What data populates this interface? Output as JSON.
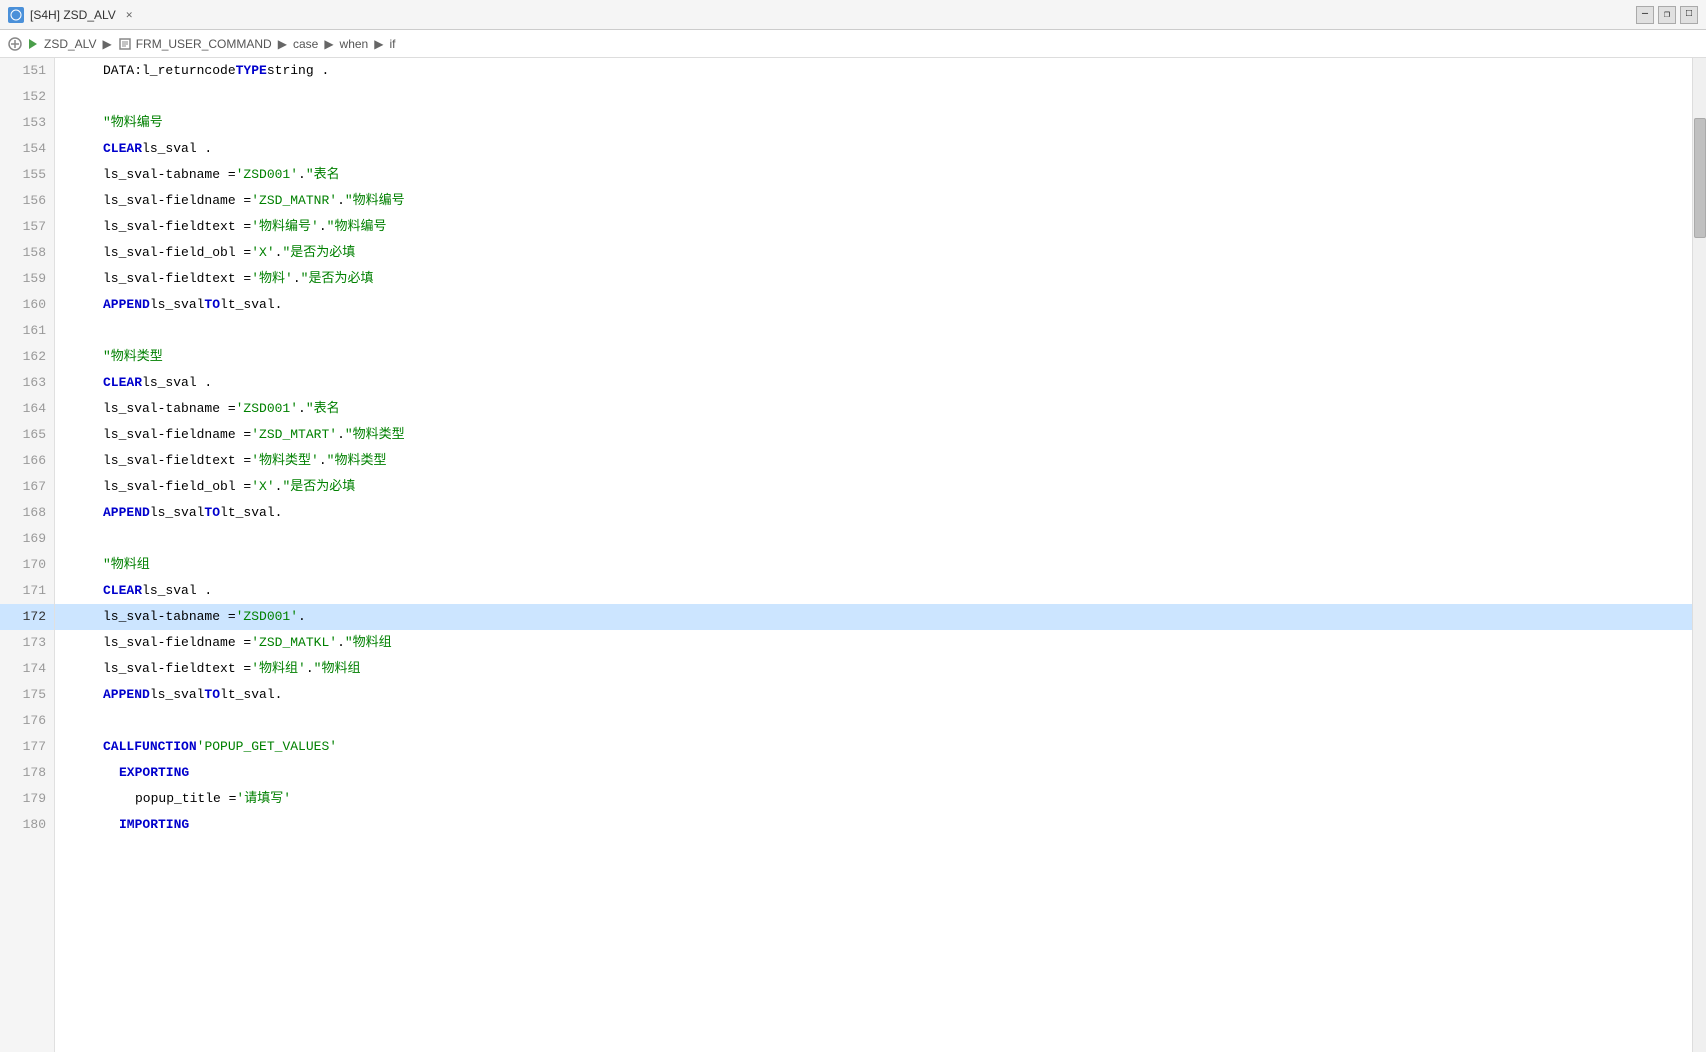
{
  "window": {
    "title": "[S4H] ZSD_ALV",
    "close_label": "✕"
  },
  "breadcrumb": {
    "items": [
      "ZSD_ALV",
      "FRM_USER_COMMAND",
      "case",
      "when",
      "if"
    ]
  },
  "window_controls": {
    "minimize": "—",
    "maximize": "□",
    "restore": "❐"
  },
  "lines": [
    {
      "num": "151",
      "active": false,
      "tokens": [
        {
          "type": "indent",
          "w": 32
        },
        {
          "type": "plain",
          "text": "DATA:l_returncode "
        },
        {
          "type": "kw",
          "text": "TYPE"
        },
        {
          "type": "plain",
          "text": " string ."
        }
      ]
    },
    {
      "num": "152",
      "active": false,
      "tokens": []
    },
    {
      "num": "153",
      "active": false,
      "tokens": [
        {
          "type": "indent",
          "w": 32
        },
        {
          "type": "comment",
          "text": "\"物料编号"
        }
      ]
    },
    {
      "num": "154",
      "active": false,
      "tokens": [
        {
          "type": "indent",
          "w": 32
        },
        {
          "type": "kw",
          "text": "CLEAR"
        },
        {
          "type": "plain",
          "text": " ls_sval ."
        }
      ]
    },
    {
      "num": "155",
      "active": false,
      "tokens": [
        {
          "type": "indent",
          "w": 32
        },
        {
          "type": "plain",
          "text": "ls_sval-tabname = "
        },
        {
          "type": "str",
          "text": "'ZSD001'"
        },
        {
          "type": "plain",
          "text": " .   "
        },
        {
          "type": "comment",
          "text": "\"表名"
        }
      ]
    },
    {
      "num": "156",
      "active": false,
      "tokens": [
        {
          "type": "indent",
          "w": 32
        },
        {
          "type": "plain",
          "text": "ls_sval-fieldname = "
        },
        {
          "type": "str",
          "text": "'ZSD_MATNR'"
        },
        {
          "type": "plain",
          "text": " . "
        },
        {
          "type": "comment",
          "text": "\"物料编号"
        }
      ]
    },
    {
      "num": "157",
      "active": false,
      "tokens": [
        {
          "type": "indent",
          "w": 32
        },
        {
          "type": "plain",
          "text": "ls_sval-fieldtext = "
        },
        {
          "type": "str",
          "text": "'物料编号'"
        },
        {
          "type": "plain",
          "text": " . "
        },
        {
          "type": "comment",
          "text": "\"物料编号"
        }
      ]
    },
    {
      "num": "158",
      "active": false,
      "tokens": [
        {
          "type": "indent",
          "w": 32
        },
        {
          "type": "plain",
          "text": "ls_sval-field_obl = "
        },
        {
          "type": "str",
          "text": "'X'"
        },
        {
          "type": "plain",
          "text": " .              "
        },
        {
          "type": "comment",
          "text": "\"是否为必填"
        }
      ]
    },
    {
      "num": "159",
      "active": false,
      "tokens": [
        {
          "type": "indent",
          "w": 32
        },
        {
          "type": "plain",
          "text": "ls_sval-fieldtext = "
        },
        {
          "type": "str",
          "text": "'物料'"
        },
        {
          "type": "plain",
          "text": " .              "
        },
        {
          "type": "comment",
          "text": "\"是否为必填"
        }
      ]
    },
    {
      "num": "160",
      "active": false,
      "tokens": [
        {
          "type": "indent",
          "w": 32
        },
        {
          "type": "kw",
          "text": "APPEND"
        },
        {
          "type": "plain",
          "text": " ls_sval "
        },
        {
          "type": "kw",
          "text": "TO"
        },
        {
          "type": "plain",
          "text": " lt_sval."
        }
      ]
    },
    {
      "num": "161",
      "active": false,
      "tokens": []
    },
    {
      "num": "162",
      "active": false,
      "tokens": [
        {
          "type": "indent",
          "w": 32
        },
        {
          "type": "comment",
          "text": "\"物料类型"
        }
      ]
    },
    {
      "num": "163",
      "active": false,
      "tokens": [
        {
          "type": "indent",
          "w": 32
        },
        {
          "type": "kw",
          "text": "CLEAR"
        },
        {
          "type": "plain",
          "text": " ls_sval ."
        }
      ]
    },
    {
      "num": "164",
      "active": false,
      "tokens": [
        {
          "type": "indent",
          "w": 32
        },
        {
          "type": "plain",
          "text": "ls_sval-tabname = "
        },
        {
          "type": "str",
          "text": "'ZSD001'"
        },
        {
          "type": "plain",
          "text": " .   "
        },
        {
          "type": "comment",
          "text": "\"表名"
        }
      ]
    },
    {
      "num": "165",
      "active": false,
      "tokens": [
        {
          "type": "indent",
          "w": 32
        },
        {
          "type": "plain",
          "text": "ls_sval-fieldname = "
        },
        {
          "type": "str",
          "text": "'ZSD_MTART'"
        },
        {
          "type": "plain",
          "text": " . "
        },
        {
          "type": "comment",
          "text": "\"物料类型"
        }
      ]
    },
    {
      "num": "166",
      "active": false,
      "tokens": [
        {
          "type": "indent",
          "w": 32
        },
        {
          "type": "plain",
          "text": "ls_sval-fieldtext = "
        },
        {
          "type": "str",
          "text": "'物料类型'"
        },
        {
          "type": "plain",
          "text": " . "
        },
        {
          "type": "comment",
          "text": "\"物料类型"
        }
      ]
    },
    {
      "num": "167",
      "active": false,
      "tokens": [
        {
          "type": "indent",
          "w": 32
        },
        {
          "type": "plain",
          "text": "ls_sval-field_obl = "
        },
        {
          "type": "str",
          "text": "'X'"
        },
        {
          "type": "plain",
          "text": " .              "
        },
        {
          "type": "comment",
          "text": "\"是否为必填"
        }
      ]
    },
    {
      "num": "168",
      "active": false,
      "tokens": [
        {
          "type": "indent",
          "w": 32
        },
        {
          "type": "kw",
          "text": "APPEND"
        },
        {
          "type": "plain",
          "text": " ls_sval "
        },
        {
          "type": "kw",
          "text": "TO"
        },
        {
          "type": "plain",
          "text": " lt_sval."
        }
      ]
    },
    {
      "num": "169",
      "active": false,
      "tokens": []
    },
    {
      "num": "170",
      "active": false,
      "tokens": [
        {
          "type": "indent",
          "w": 32
        },
        {
          "type": "comment",
          "text": "\"物料组"
        }
      ]
    },
    {
      "num": "171",
      "active": false,
      "tokens": [
        {
          "type": "indent",
          "w": 32
        },
        {
          "type": "kw",
          "text": "CLEAR"
        },
        {
          "type": "plain",
          "text": " ls_sval ."
        }
      ]
    },
    {
      "num": "172",
      "active": true,
      "tokens": [
        {
          "type": "indent",
          "w": 32
        },
        {
          "type": "plain",
          "text": "ls_sval-tabname = "
        },
        {
          "type": "str",
          "text": "'ZSD001'"
        },
        {
          "type": "plain",
          "text": "."
        }
      ]
    },
    {
      "num": "173",
      "active": false,
      "tokens": [
        {
          "type": "indent",
          "w": 32
        },
        {
          "type": "plain",
          "text": "ls_sval-fieldname = "
        },
        {
          "type": "str",
          "text": "'ZSD_MATKL'"
        },
        {
          "type": "plain",
          "text": ". "
        },
        {
          "type": "comment",
          "text": "\"物料组"
        }
      ]
    },
    {
      "num": "174",
      "active": false,
      "tokens": [
        {
          "type": "indent",
          "w": 32
        },
        {
          "type": "plain",
          "text": "ls_sval-fieldtext = "
        },
        {
          "type": "str",
          "text": "'物料组'"
        },
        {
          "type": "plain",
          "text": ". "
        },
        {
          "type": "comment",
          "text": "\"物料组"
        }
      ]
    },
    {
      "num": "175",
      "active": false,
      "tokens": [
        {
          "type": "indent",
          "w": 32
        },
        {
          "type": "kw",
          "text": "APPEND"
        },
        {
          "type": "plain",
          "text": " ls_sval "
        },
        {
          "type": "kw",
          "text": "TO"
        },
        {
          "type": "plain",
          "text": " lt_sval."
        }
      ]
    },
    {
      "num": "176",
      "active": false,
      "tokens": []
    },
    {
      "num": "177",
      "active": false,
      "tokens": [
        {
          "type": "indent",
          "w": 32
        },
        {
          "type": "kw",
          "text": "CALL"
        },
        {
          "type": "plain",
          "text": " "
        },
        {
          "type": "kw",
          "text": "FUNCTION"
        },
        {
          "type": "plain",
          "text": " "
        },
        {
          "type": "str",
          "text": "'POPUP_GET_VALUES'"
        }
      ]
    },
    {
      "num": "178",
      "active": false,
      "tokens": [
        {
          "type": "indent",
          "w": 48
        },
        {
          "type": "kw",
          "text": "EXPORTING"
        }
      ]
    },
    {
      "num": "179",
      "active": false,
      "tokens": [
        {
          "type": "indent",
          "w": 64
        },
        {
          "type": "plain",
          "text": "popup_title       = "
        },
        {
          "type": "str",
          "text": "'请填写'"
        }
      ]
    },
    {
      "num": "180",
      "active": false,
      "tokens": [
        {
          "type": "indent",
          "w": 48
        },
        {
          "type": "kw",
          "text": "IMPORTING"
        }
      ]
    }
  ]
}
